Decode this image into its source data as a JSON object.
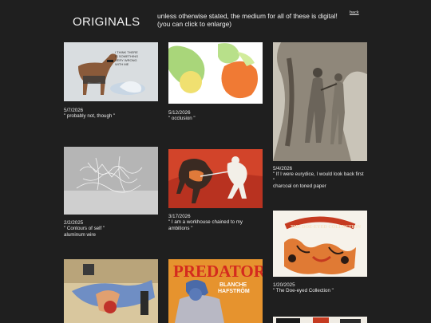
{
  "header": {
    "title": "ORIGINALS",
    "notice_line1": "unless otherwise stated, the medium for all of these is digital!",
    "notice_line2": "(you can click to enlarge)",
    "back_label": "back"
  },
  "artworks": [
    {
      "date": "5/7/2026",
      "caption": "\" probably not, though \"",
      "medium": "",
      "thumb_text": "I THINK THERE IS SOMETHING VERY WRONG WITH ME"
    },
    {
      "date": "5/12/2026",
      "caption": "\" occlusion \"",
      "medium": ""
    },
    {
      "date": "5/4/2026",
      "caption": "\" If I were eurydice, I would look back first",
      "caption2": "\"",
      "medium": "charcoal on toned paper"
    },
    {
      "date": "2/2/2025",
      "caption": "\" Contours of self \"",
      "medium": "aluminum wire"
    },
    {
      "date": "3/17/2026",
      "caption": "\" I am a workhouse chained to my",
      "caption2": "ambitions \"",
      "medium": ""
    },
    {
      "date": "1/20/2025",
      "caption": "\" The Doe-eyed Collection \"",
      "medium": "",
      "thumb_text": "THE DOE-EYED COLLECTION"
    },
    {
      "date": "",
      "caption": "",
      "medium": ""
    },
    {
      "date": "",
      "caption": "",
      "medium": "",
      "thumb_title": "PREDATOR",
      "thumb_sub1": "BLANCHE",
      "thumb_sub2": "HAFSTRÖM"
    },
    {
      "date": "",
      "caption": "",
      "medium": ""
    }
  ],
  "colors": {
    "background": "#1f1f1f",
    "text": "#e6e6e6"
  }
}
